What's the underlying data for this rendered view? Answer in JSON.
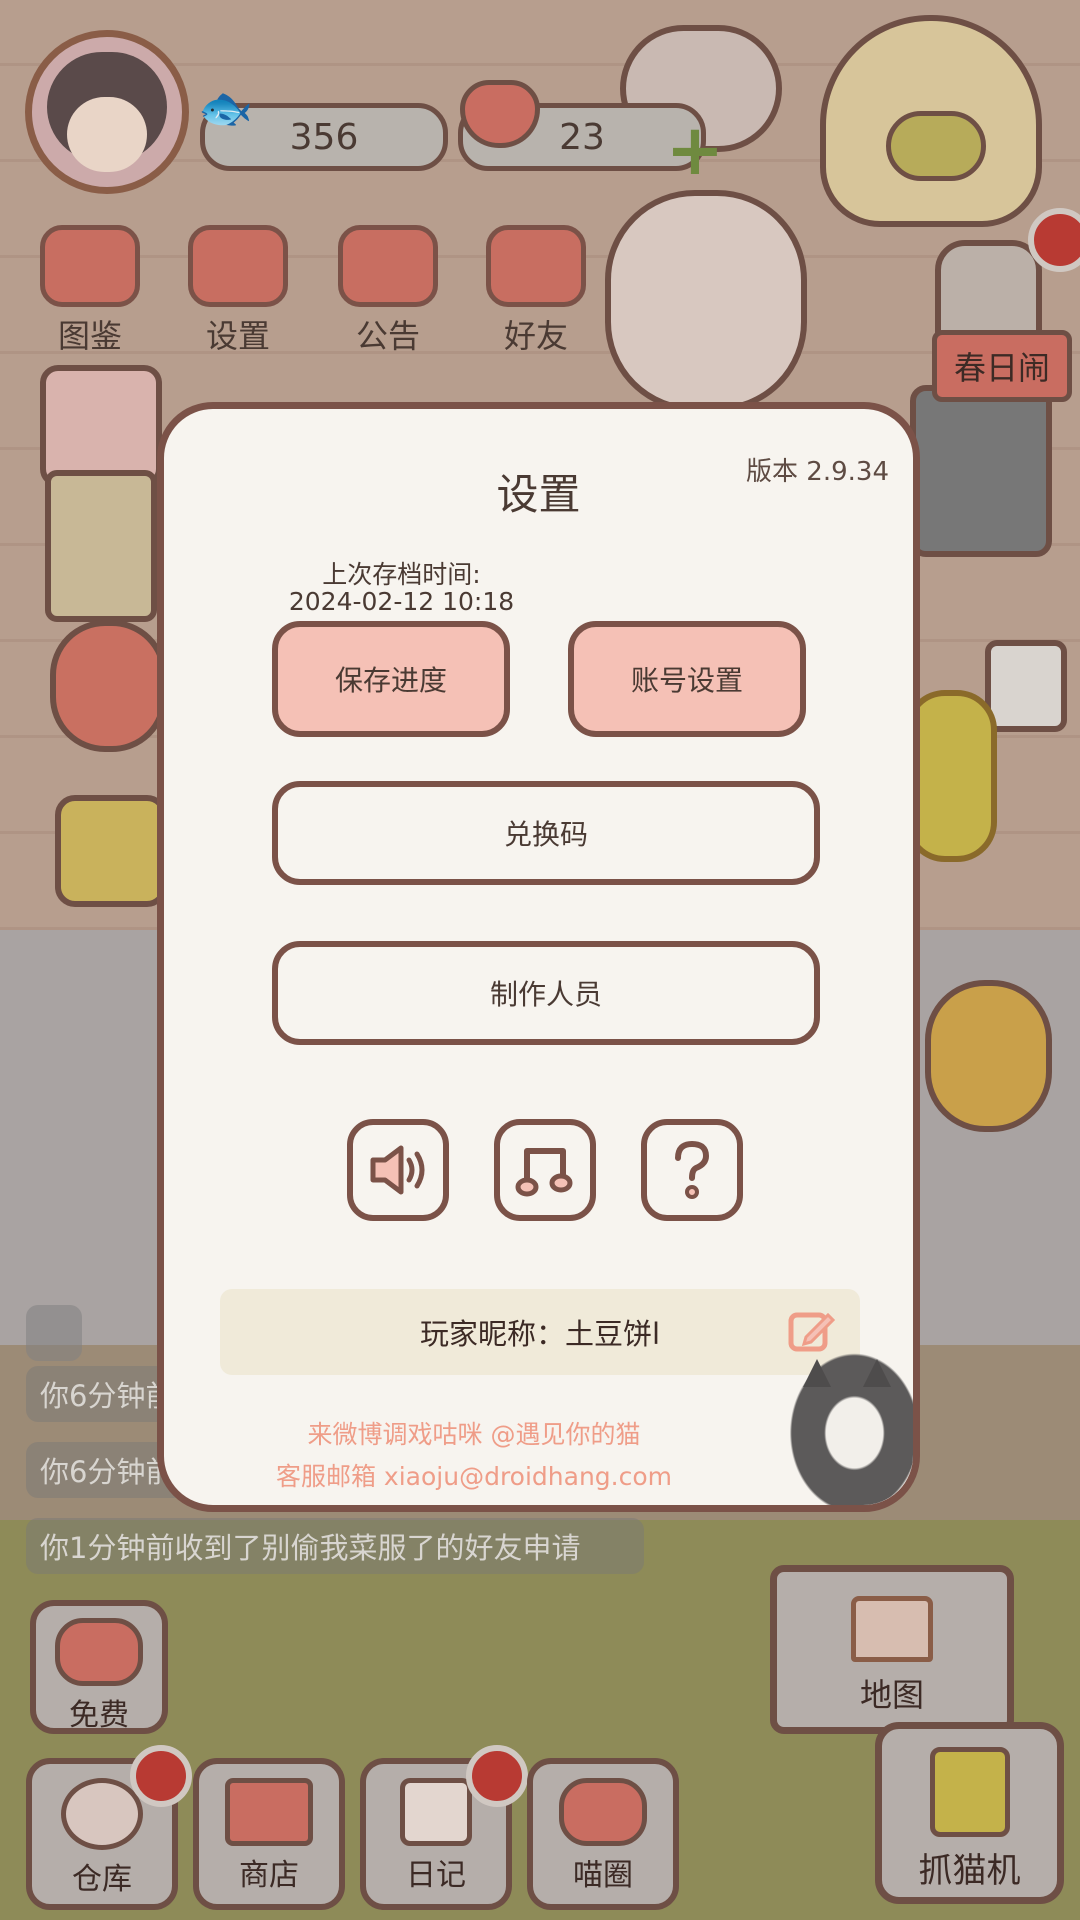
{
  "top_bar": {
    "fish_count": "356",
    "heart_count": "23"
  },
  "menu": [
    {
      "label": "图鉴",
      "icon": "cat-book-icon"
    },
    {
      "label": "设置",
      "icon": "gear-icon"
    },
    {
      "label": "公告",
      "icon": "gift-icon"
    },
    {
      "label": "好友",
      "icon": "friends-icon"
    }
  ],
  "event_sign": "春日闹",
  "chat": [
    "你6分钟前",
    "你6分钟前",
    "你1分钟前收到了别偷我菜服了的好友申请"
  ],
  "dialog": {
    "title": "设置",
    "version": "版本 2.9.34",
    "save_time_label": "上次存档时间:",
    "save_time_value": "2024-02-12 10:18",
    "save_button": "保存进度",
    "account_button": "账号设置",
    "redeem_button": "兑换码",
    "credits_button": "制作人员",
    "nickname": "玩家昵称：土豆饼l",
    "weibo_line": "来微博调戏咕咪 @遇见你的猫",
    "email_line": "客服邮箱 xiaoju@droidhang.com"
  },
  "bottom_nav": {
    "free": "免费",
    "warehouse": "仓库",
    "shop": "商店",
    "diary": "日记",
    "meow_circle": "喵圈",
    "map": "地图",
    "claw_machine": "抓猫机"
  },
  "colors": {
    "accent_pink": "#f5c1b6",
    "border_brown": "#7b5248",
    "dialog_bg": "#f7f4ef",
    "link_salmon": "#ef9d88",
    "badge_red": "#b83a33"
  }
}
